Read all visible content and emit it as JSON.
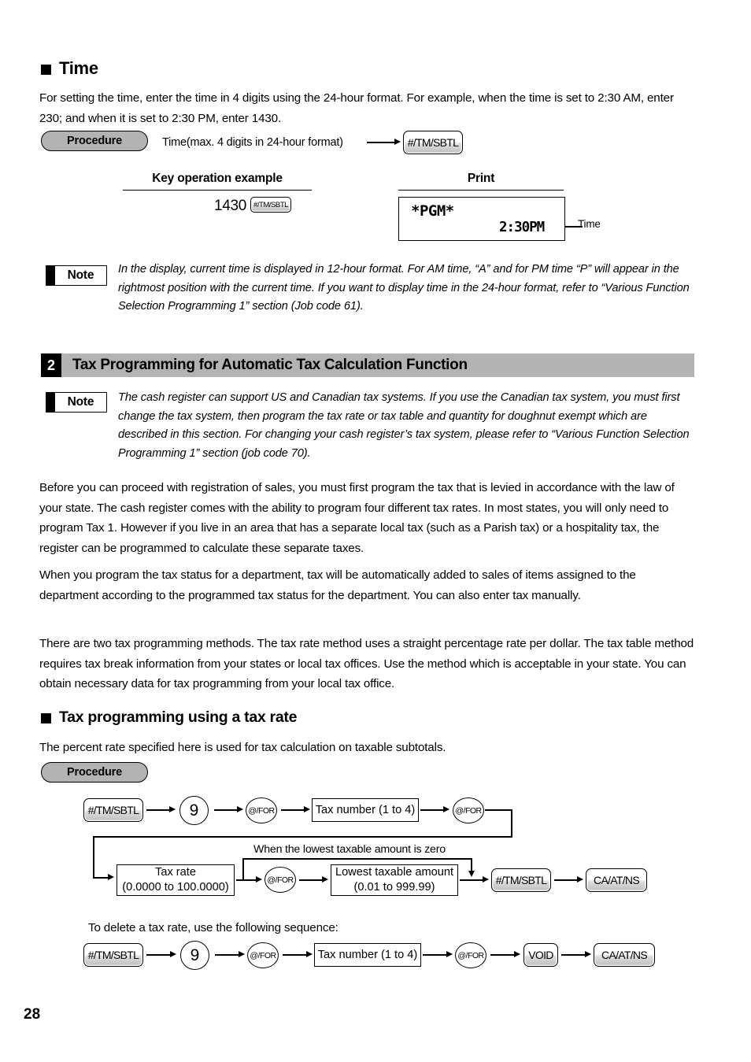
{
  "page": {
    "number": "28"
  },
  "time_section": {
    "heading": "Time",
    "intro": "For setting the time, enter the time in 4 digits using the 24-hour format.  For example, when the time is set to 2:30 AM, enter 230; and when it is set to 2:30 PM, enter 1430.",
    "procedure_label": "Procedure",
    "procedure_input_label": "Time(max. 4 digits in 24-hour format)",
    "procedure_key": "#/TM/SBTL",
    "columns": {
      "key_operation": "Key operation example",
      "print": "Print"
    },
    "key_example": {
      "digits": "1430",
      "key": "#/TM/SBTL"
    },
    "print": {
      "header": "*PGM*",
      "time": "2:30PM",
      "callout": "Time"
    },
    "note": {
      "label": "Note",
      "text": "In the display, current time is displayed in 12-hour format.  For AM time, “A” and for PM time “P” will appear in the rightmost position with the current time.  If you want to display time in the 24-hour format, refer to “Various Function Selection Programming 1” section (Job code 61)."
    }
  },
  "tax_section": {
    "number": "2",
    "title": "Tax Programming for Automatic Tax Calculation Function",
    "note": {
      "label": "Note",
      "text": "The cash register can support US and Canadian tax systems.  If you use the Canadian tax system, you must first change the tax system, then program the tax rate or tax table and quantity for doughnut exempt which are described in this section.  For changing your cash register’s tax system, please refer to “Various Function Selection Programming 1” section (job code 70)."
    },
    "paragraphs": [
      "Before you can proceed with registration of sales, you must first program the tax that is levied in accordance with the law of your state.  The cash register comes with the ability to program four different tax rates.  In most states, you will only need to program Tax 1.  However if you live in an area that has a separate local tax (such as a Parish tax) or a hospitality tax, the register can be programmed to calculate these separate taxes.",
      "When you program the tax status for a department, tax will be automatically added to sales of items assigned to the department according to the programmed tax status for the department.  You can also enter tax manually.",
      "There are two tax programming methods.  The tax rate method uses a straight percentage rate per dollar.  The tax table method requires tax break information from your states or local tax offices.  Use the method which is acceptable in your state.  You can obtain necessary data for tax programming from your local tax office."
    ]
  },
  "tax_rate_section": {
    "heading": "Tax programming using a tax rate",
    "intro": "The percent rate specified here is used for tax calculation on taxable subtotals.",
    "procedure_label": "Procedure",
    "flow": {
      "row1": {
        "key_tmsbtl": "#/TM/SBTL",
        "key_nine": "9",
        "key_for_1": "@/FOR",
        "box_tax_number": "Tax number (1 to 4)",
        "key_for_2": "@/FOR"
      },
      "bypass_caption": "When the lowest taxable amount is zero",
      "row2": {
        "box_tax_rate_line1": "Tax rate",
        "box_tax_rate_line2": "(0.0000 to 100.0000)",
        "key_for_3": "@/FOR",
        "box_lowest_line1": "Lowest taxable amount",
        "box_lowest_line2": "(0.01 to 999.99)",
        "key_tmsbtl": "#/TM/SBTL",
        "key_caatns": "CA/AT/NS"
      }
    },
    "delete_intro": "To delete a tax rate, use the following sequence:",
    "delete_flow": {
      "key_tmsbtl": "#/TM/SBTL",
      "key_nine": "9",
      "key_for_1": "@/FOR",
      "box_tax_number": "Tax number (1 to 4)",
      "key_for_2": "@/FOR",
      "key_void": "VOID",
      "key_caatns": "CA/AT/NS"
    }
  },
  "colors": {
    "bar_gray": "#b3b3b3",
    "ink": "#000000",
    "paper": "#ffffff"
  }
}
